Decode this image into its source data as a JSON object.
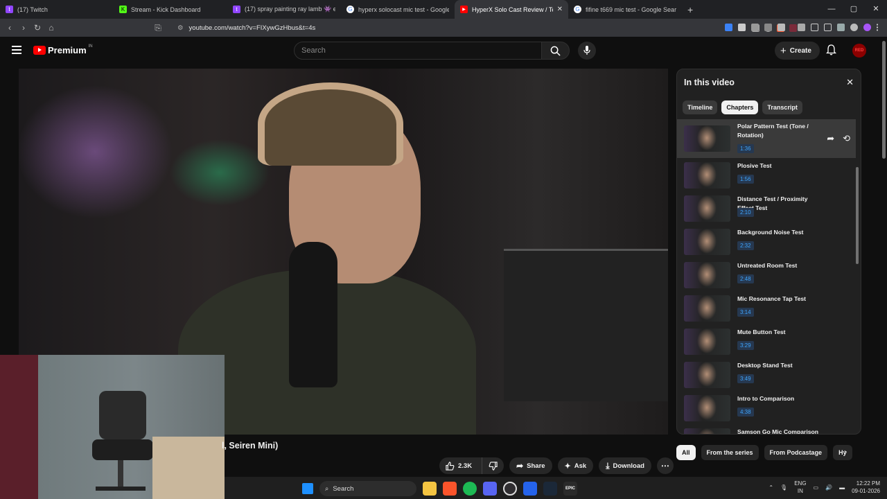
{
  "browser": {
    "tabs": [
      {
        "title": "(17) Twitch",
        "color": "#9146ff",
        "glyph": "t"
      },
      {
        "title": "Stream - Kick Dashboard",
        "color": "#53fc18",
        "glyph": "K"
      },
      {
        "title": "(17) spray painting ray lamb 👾 early",
        "color": "#9146ff",
        "glyph": "t"
      },
      {
        "title": "hyperx solocast mic test - Google Se",
        "color": "#ffffff",
        "glyph": "G"
      },
      {
        "title": "HyperX Solo Cast Review / Test |",
        "color": "#ff0000",
        "glyph": "▶",
        "active": true
      },
      {
        "title": "fifine t669 mic test - Google Search",
        "color": "#ffffff",
        "glyph": "G"
      }
    ],
    "url": "youtube.com/watch?v=FIXywGzHbus&t=4s",
    "new_tab": "+",
    "win_min": "—",
    "win_max": "▢",
    "win_close": "✕"
  },
  "youtube": {
    "logo_text": "Premium",
    "logo_region": "IN",
    "search_placeholder": "Search",
    "create_label": "Create",
    "avatar_text": "RED"
  },
  "video": {
    "title_visible": "l, Seiren Mini)"
  },
  "actions": {
    "like_count": "2.3K",
    "share": "Share",
    "ask": "Ask",
    "download": "Download"
  },
  "panel": {
    "title": "In this video",
    "tabs": [
      "Timeline",
      "Chapters",
      "Transcript"
    ],
    "active_tab": "Chapters",
    "chapters": [
      {
        "title": "Polar Pattern Test (Tone / Rotation)",
        "time": "1:36"
      },
      {
        "title": "Plosive Test",
        "time": "1:56"
      },
      {
        "title": "Distance Test / Proximity Effect Test",
        "time": "2:10"
      },
      {
        "title": "Background Noise Test",
        "time": "2:32"
      },
      {
        "title": "Untreated Room Test",
        "time": "2:48"
      },
      {
        "title": "Mic Resonance Tap Test",
        "time": "3:14"
      },
      {
        "title": "Mute Button Test",
        "time": "3:29"
      },
      {
        "title": "Desktop Stand Test",
        "time": "3:49"
      },
      {
        "title": "Intro to Comparison",
        "time": "4:38"
      },
      {
        "title": "Samson Go Mic Comparison",
        "time": ""
      }
    ]
  },
  "chips": [
    "All",
    "From the series",
    "From Podcastage",
    "Hy"
  ],
  "taskbar": {
    "search": "Search",
    "lang": "ENG",
    "lang_region": "IN",
    "time": "12:22 PM",
    "date": "09-01-2026"
  },
  "colors": {
    "accent_red": "#ff0000",
    "timestamp_blue": "#3ea6ff"
  }
}
